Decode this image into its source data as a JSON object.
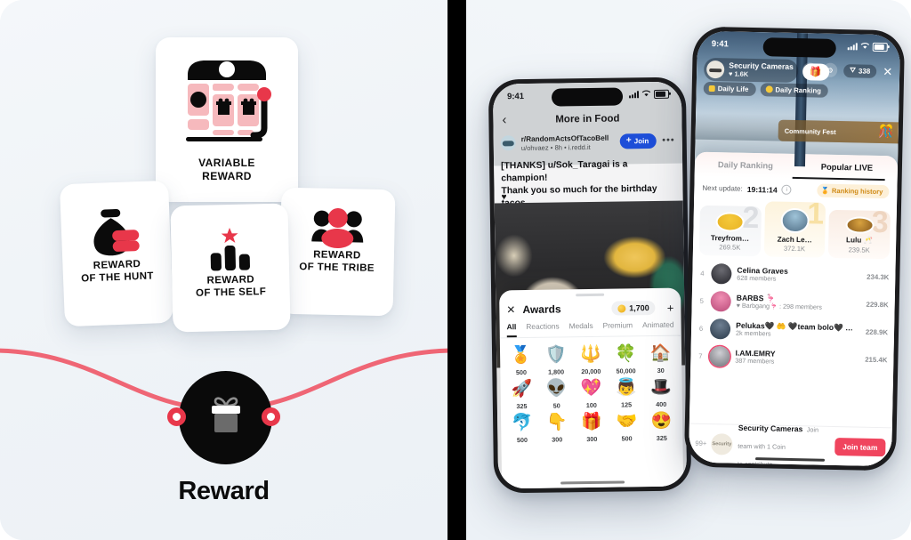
{
  "left": {
    "title": "Reward",
    "cards": [
      {
        "id": "variable",
        "label": "VARIABLE\nREWARD",
        "icon": "slot-machine-icon"
      },
      {
        "id": "hunt",
        "label": "REWARD\nOF THE HUNT",
        "icon": "money-bag-icon"
      },
      {
        "id": "self",
        "label": "REWARD\nOF THE SELF",
        "icon": "podium-star-icon"
      },
      {
        "id": "tribe",
        "label": "REWARD\nOF THE TRIBE",
        "icon": "people-group-icon"
      }
    ],
    "node_icon": "gift-icon",
    "colors": {
      "accent_red": "#e8374a",
      "curve_red": "#ef5a69",
      "pink": "#f6b9bd",
      "black": "#0a0a0a",
      "background": "#f1f5f8"
    }
  },
  "phone_reddit": {
    "status": {
      "time": "9:41",
      "signal_icon": "cellular-bars-icon",
      "wifi_icon": "wifi-icon",
      "battery_icon": "battery-icon"
    },
    "nav": {
      "back_icon": "chevron-left-icon",
      "title": "More in Food"
    },
    "post": {
      "subreddit": "r/RandomActsOfTacoBell",
      "meta": "u/ohvaez • 8h • i.redd.it",
      "join_label": "Join",
      "join_icon": "plus-icon",
      "overflow_icon": "more-horizontal-icon",
      "title": "[THANKS] u/Sok_Taragai is a champion!\nThank you so much for the birthday tacos",
      "heart_icon": "heart-icon",
      "image_alt": "photo-of-taco-bell-food"
    },
    "awards": {
      "close_icon": "close-icon",
      "title": "Awards",
      "coin_balance": "1,700",
      "coin_icon": "coin-icon",
      "add_icon": "plus-icon",
      "tabs": [
        "All",
        "Reactions",
        "Medals",
        "Premium",
        "Animated"
      ],
      "active_tab": "All",
      "items": [
        {
          "art": "🏅",
          "cost": "500"
        },
        {
          "art": "🛡️",
          "cost": "1,800"
        },
        {
          "art": "🔱",
          "cost": "20,000"
        },
        {
          "art": "🍀",
          "cost": "50,000"
        },
        {
          "art": "🏠",
          "cost": "30"
        },
        {
          "art": "🚀",
          "cost": "325"
        },
        {
          "art": "👽",
          "cost": "50"
        },
        {
          "art": "💖",
          "cost": "100"
        },
        {
          "art": "👼",
          "cost": "125"
        },
        {
          "art": "🎩",
          "cost": "400"
        },
        {
          "art": "🐬",
          "cost": "500"
        },
        {
          "art": "👇",
          "cost": "300"
        },
        {
          "art": "🎁",
          "cost": "300"
        },
        {
          "art": "🤝",
          "cost": "500"
        },
        {
          "art": "😍",
          "cost": "325"
        }
      ]
    }
  },
  "phone_live": {
    "status": {
      "time": "9:41",
      "signal_icon": "cellular-bars-icon",
      "wifi_icon": "wifi-icon",
      "battery_icon": "battery-icon"
    },
    "creator": {
      "name": "Security Cameras",
      "likes": "1.6K",
      "like_icon": "heart-icon",
      "gift_icon": "gift-box-icon",
      "avatar": "creator-avatar"
    },
    "toolbar": {
      "share_icon": "share-icon",
      "settings_icon": "gear-icon",
      "viewers": "338",
      "viewers_icon": "person-icon",
      "close_icon": "close-icon"
    },
    "tags": [
      {
        "label": "Daily Life",
        "icon": "square-badge-icon"
      },
      {
        "label": "Daily Ranking",
        "icon": "circle-badge-icon"
      }
    ],
    "banner": {
      "label": "Community Fest",
      "emoji": "🎊"
    },
    "sheet": {
      "tabs": [
        "Daily Ranking",
        "Popular LIVE"
      ],
      "active_tab": "Popular LIVE",
      "next_update_label": "Next update:",
      "next_update_time": "19:11:14",
      "info_icon": "info-icon",
      "ranking_history_label": "Ranking history",
      "ranking_history_icon": "trophy-icon",
      "podium": [
        {
          "rank": "2",
          "name": "Treyfrom…",
          "score": "269.5K"
        },
        {
          "rank": "1",
          "name": "Zach Le…",
          "score": "372.1K"
        },
        {
          "rank": "3",
          "name": "Lulu 🥂",
          "score": "239.5K"
        }
      ],
      "rows": [
        {
          "rank": "4",
          "name": "Celina Graves",
          "sub": "628 members",
          "score": "234.3K"
        },
        {
          "rank": "5",
          "name": "BARBS 🦩",
          "sub": "♥ Barbgang🦩 : 298 members",
          "score": "229.8K"
        },
        {
          "rank": "6",
          "name": "Pelukas🖤 🤲 🖤team bolo🖤 …",
          "sub": "2k members",
          "score": "228.9K"
        },
        {
          "rank": "7",
          "name": "I.AM.EMRY",
          "sub": "387 members",
          "score": "215.4K"
        }
      ],
      "join_bar": {
        "rank": "99+",
        "avatar_text": "Security",
        "title": "Security Cameras",
        "desc": "Join team with 1 Coin\nto contribute",
        "button_label": "Join team"
      }
    }
  }
}
